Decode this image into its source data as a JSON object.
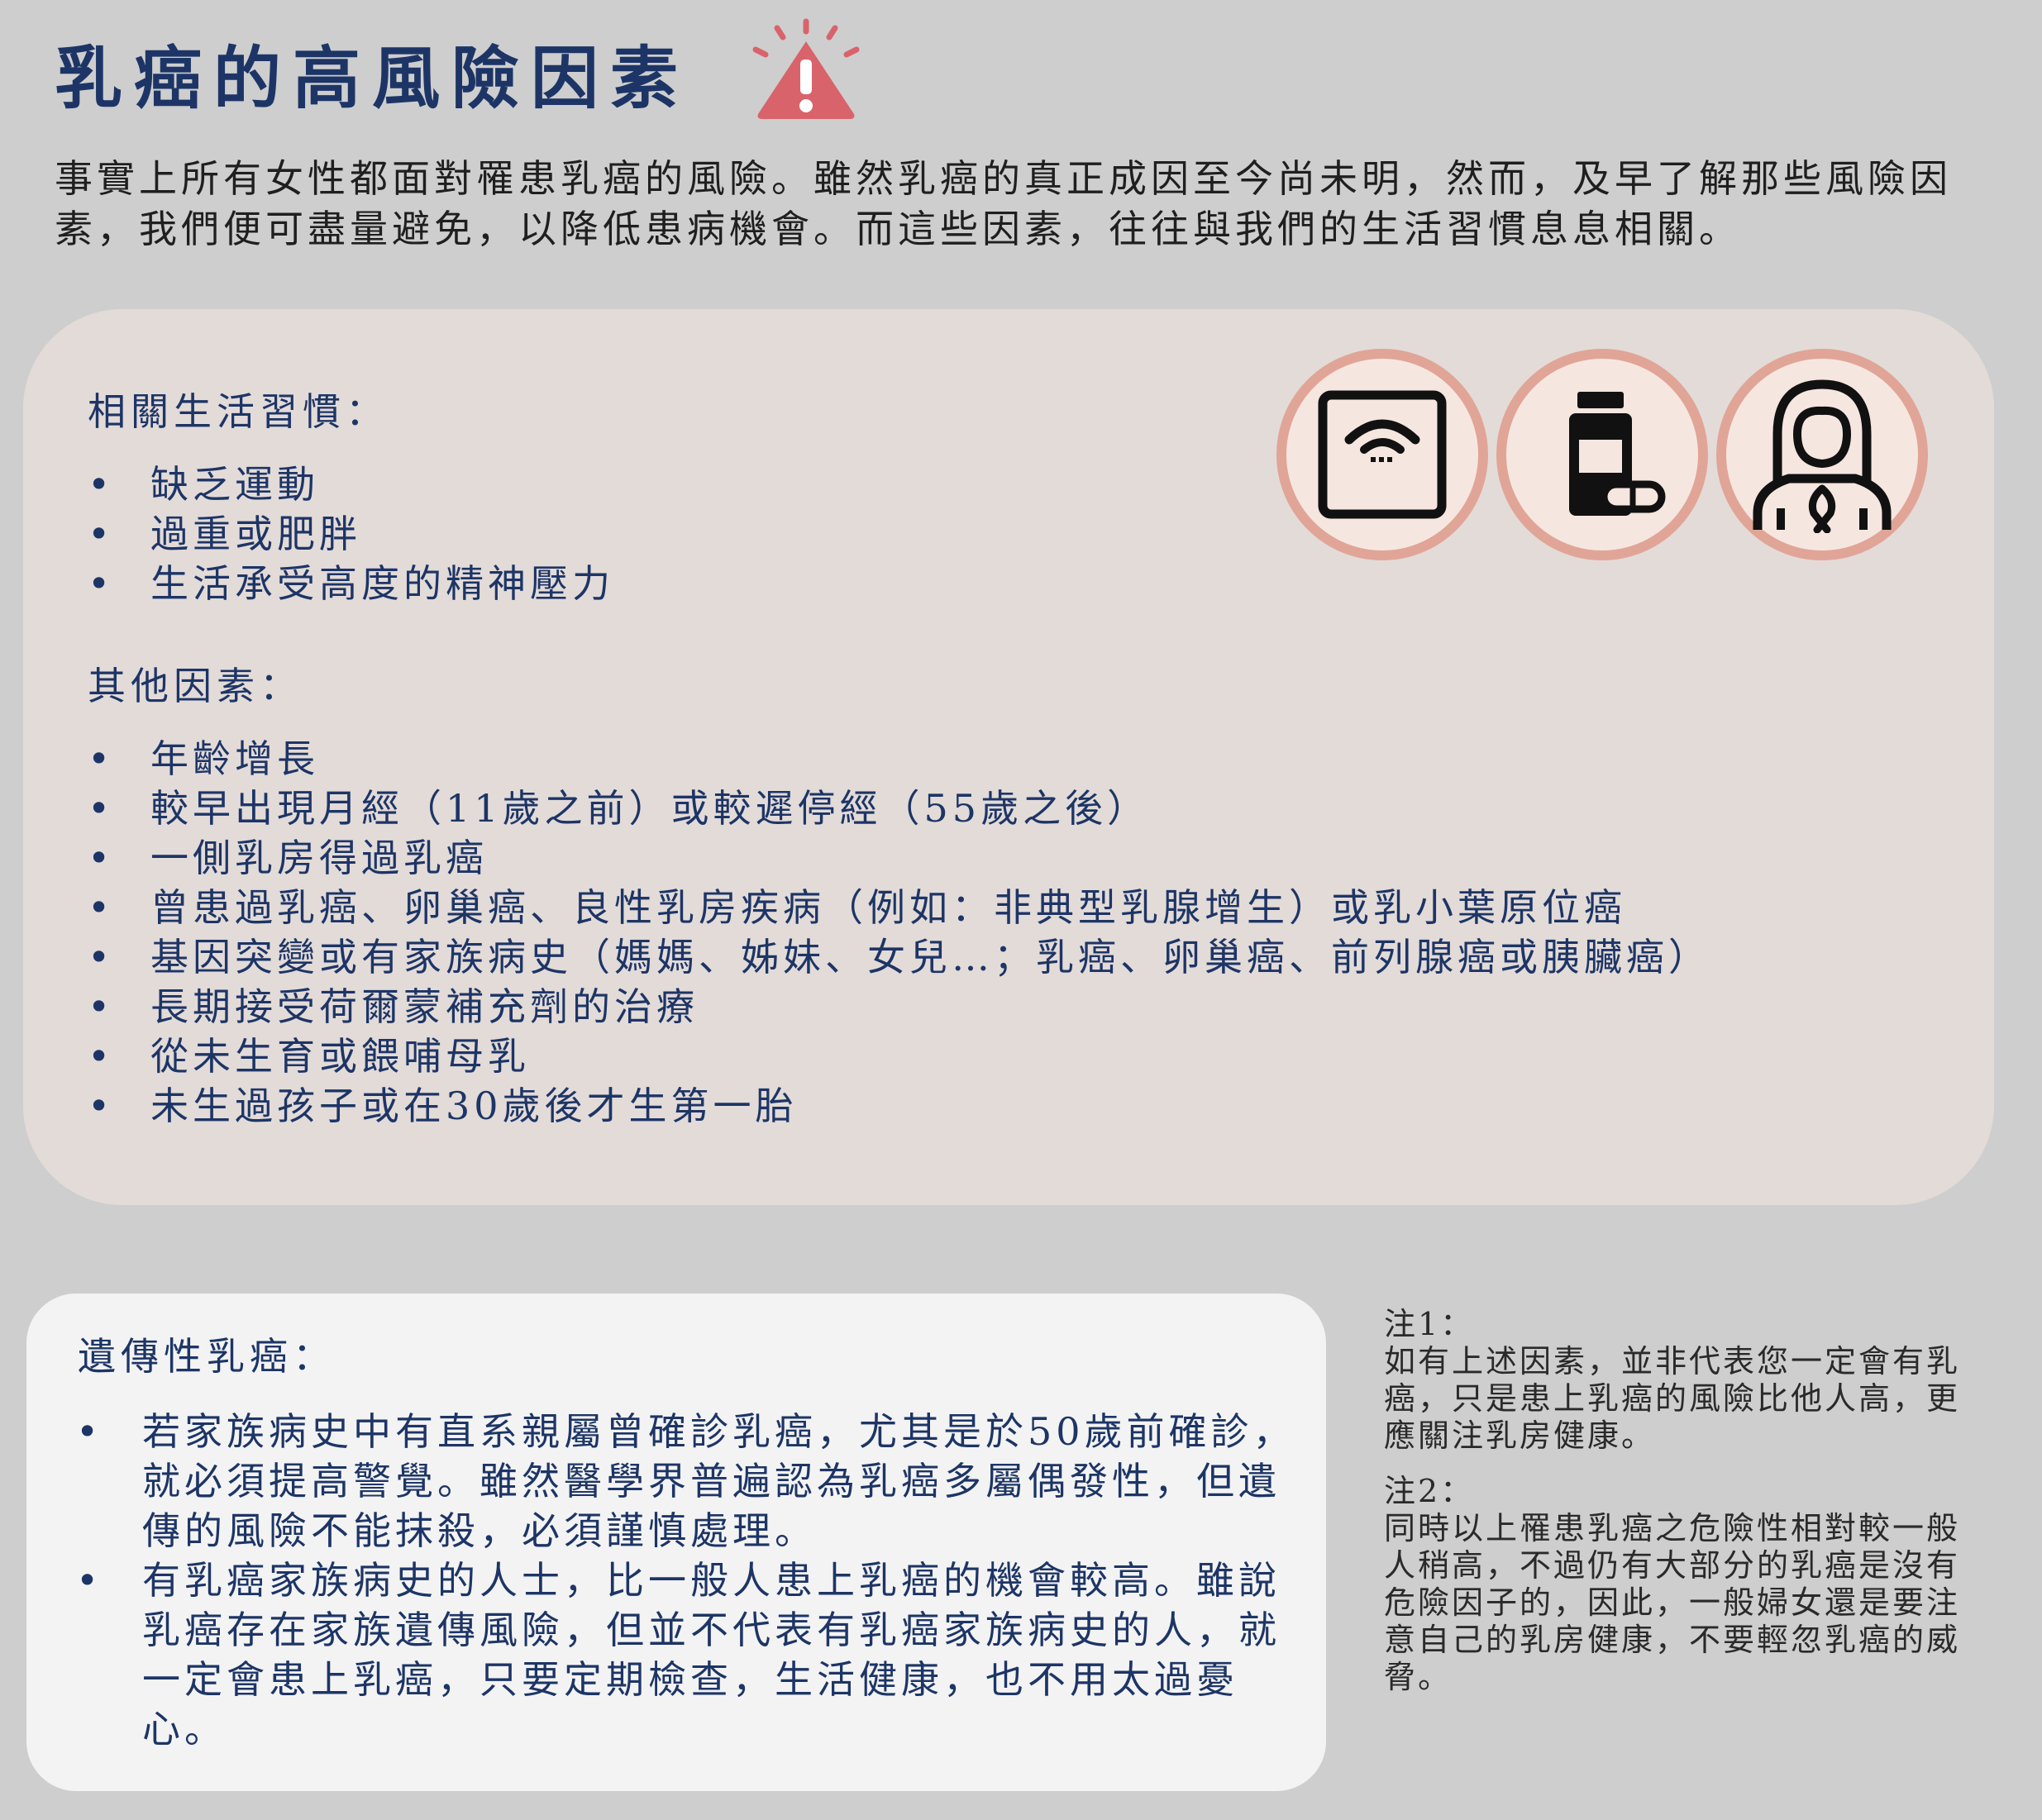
{
  "title": "乳癌的高風險因素",
  "intro": "事實上所有女性都面對罹患乳癌的風險。雖然乳癌的真正成因至今尚未明，然而，及早了解那些風險因素，我們便可盡量避免，以降低患病機會。而這些因素，往往與我們的生活習慣息息相關。",
  "lifestyle": {
    "heading": "相關生活習慣：",
    "items": [
      "缺乏運動",
      "過重或肥胖",
      "生活承受高度的精神壓力"
    ]
  },
  "other": {
    "heading": "其他因素：",
    "items": [
      "年齡增長",
      "較早出現月經（11歲之前）或較遲停經（55歲之後）",
      "一側乳房得過乳癌",
      "曾患過乳癌、卵巢癌、良性乳房疾病（例如：非典型乳腺增生）或乳小葉原位癌",
      "基因突變或有家族病史（媽媽、姊妹、女兒…；乳癌、卵巢癌、前列腺癌或胰臟癌）",
      "長期接受荷爾蒙補充劑的治療",
      "從未生育或餵哺母乳",
      "未生過孩子或在30歲後才生第一胎"
    ]
  },
  "icons": [
    "scale-icon",
    "medicine-bottle-icon",
    "woman-ribbon-icon"
  ],
  "alert_icon": "warning-icon",
  "colors": {
    "title": "#1d3566",
    "accent_circle": "#e0a597",
    "alert": "#d9636b"
  },
  "hereditary": {
    "heading": "遺傳性乳癌：",
    "items": [
      "若家族病史中有直系親屬曾確診乳癌，尤其是於50歲前確診，就必須提高警覺。雖然醫學界普遍認為乳癌多屬偶發性，但遺傳的風險不能抹殺，必須謹慎處理。",
      "有乳癌家族病史的人士，比一般人患上乳癌的機會較高。雖說乳癌存在家族遺傳風險，但並不代表有乳癌家族病史的人，就一定會患上乳癌，只要定期檢查，生活健康，也不用太過憂心。"
    ]
  },
  "notes": [
    {
      "label": "注1：",
      "text": "如有上述因素，並非代表您一定會有乳癌，只是患上乳癌的風險比他人高，更應關注乳房健康。"
    },
    {
      "label": "注2：",
      "text": "同時以上罹患乳癌之危險性相對較一般人稍高，不過仍有大部分的乳癌是沒有危險因子的，因此，一般婦女還是要注意自己的乳房健康，不要輕忽乳癌的威脅。"
    }
  ]
}
